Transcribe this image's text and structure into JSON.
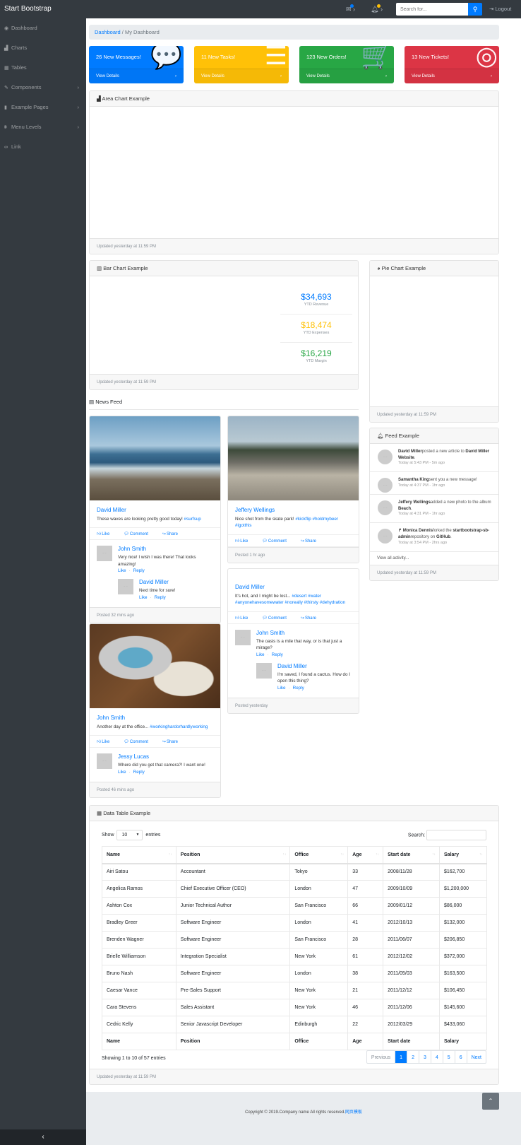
{
  "navbar": {
    "brand": "Start Bootstrap",
    "search_placeholder": "Search for...",
    "logout": "Logout",
    "icons": [
      "envelope-icon",
      "bell-icon",
      "search-icon",
      "sign-out-icon"
    ]
  },
  "sidebar": {
    "items": [
      {
        "label": "Dashboard",
        "icon": "tachometer-icon",
        "glyph": "◉",
        "chevron": ""
      },
      {
        "label": "Charts",
        "icon": "area-chart-icon",
        "glyph": "▟",
        "chevron": ""
      },
      {
        "label": "Tables",
        "icon": "table-icon",
        "glyph": "▦",
        "chevron": ""
      },
      {
        "label": "Components",
        "icon": "wrench-icon",
        "glyph": "✎",
        "chevron": "›"
      },
      {
        "label": "Example Pages",
        "icon": "file-icon",
        "glyph": "▮",
        "chevron": "›"
      },
      {
        "label": "Menu Levels",
        "icon": "sitemap-icon",
        "glyph": "⩩",
        "chevron": "›"
      },
      {
        "label": "Link",
        "icon": "link-icon",
        "glyph": "∞",
        "chevron": ""
      }
    ],
    "toggle": "‹"
  },
  "breadcrumb": {
    "home": "Dashboard",
    "current": "My Dashboard"
  },
  "stats": [
    {
      "title": "26 New Messages!",
      "link": "View Details",
      "color": "#007bff",
      "icon": "comments-icon",
      "glyph": "💬"
    },
    {
      "title": "11 New Tasks!",
      "link": "View Details",
      "color": "#ffc107",
      "icon": "list-icon",
      "glyph": "☰"
    },
    {
      "title": "123 New Orders!",
      "link": "View Details",
      "color": "#28a745",
      "icon": "shopping-cart-icon",
      "glyph": "🛒"
    },
    {
      "title": "13 New Tickets!",
      "link": "View Details",
      "color": "#dc3545",
      "icon": "support-icon",
      "glyph": "◎"
    }
  ],
  "area_chart": {
    "title": "Area Chart Example",
    "footer": "Updated yesterday at 11:59 PM"
  },
  "bar_chart": {
    "title": "Bar Chart Example",
    "footer": "Updated yesterday at 11:59 PM",
    "ytd": [
      {
        "value": "$34,693",
        "label": "YTD Revenue",
        "color": "#007bff"
      },
      {
        "value": "$18,474",
        "label": "YTD Expenses",
        "color": "#ffc107"
      },
      {
        "value": "$16,219",
        "label": "YTD Margin",
        "color": "#28a745"
      }
    ]
  },
  "pie_chart": {
    "title": "Pie Chart Example",
    "footer": "Updated yesterday at 11:59 PM"
  },
  "feed": {
    "title": "Feed Example",
    "view_all": "View all activity...",
    "footer": "Updated yesterday at 11:59 PM",
    "items": [
      {
        "name": "David Miller",
        "action": "posted a new article to ",
        "target": "David Miller Website",
        "end": ".",
        "time": "Today at 5:43 PM - 5m ago"
      },
      {
        "name": "Samantha King",
        "action": "sent you a new message!",
        "target": "",
        "end": "",
        "time": "Today at 4:37 PM - 1hr ago"
      },
      {
        "name": "Jeffery Wellings",
        "action": "added a new photo to the album ",
        "target": "Beach",
        "end": ".",
        "time": "Today at 4:31 PM - 1hr ago"
      },
      {
        "name": "Monica Dennis",
        "prefix": "↱ ",
        "action": "forked the ",
        "target": "startbootstrap-sb-admin",
        "action2": "repository on ",
        "target2": "GitHub",
        "end": ".",
        "time": "Today at 3:54 PM - 2hrs ago"
      }
    ]
  },
  "news_feed": {
    "title": "News Feed",
    "actions": [
      "Like",
      "Comment",
      "Share"
    ],
    "comment_actions": [
      "Like",
      "Reply"
    ],
    "posts": [
      {
        "author": "David Miller",
        "text": "These waves are looking pretty good today! ",
        "tags": "#surfsup",
        "image": "beach",
        "footer": "Posted 32 mins ago",
        "comments": [
          {
            "name": "John Smith",
            "text": "Very nice! I wish I was there! That looks amazing!",
            "replies": [
              {
                "name": "David Miller",
                "text": "Next time for sure!"
              }
            ]
          }
        ]
      },
      {
        "author": "Jeffery Wellings",
        "text": "Nice shot from the skate park! ",
        "tags": "#kickflip #holdmybeer #igotthis",
        "image": "skatepark",
        "footer": "Posted 1 hr ago",
        "comments": []
      },
      {
        "author": "David Miller",
        "text": "It's hot, and I might be lost... ",
        "tags": "#desert #water #anyonehavesomewater #noreally #thirsty #dehydration",
        "image": "",
        "footer": "Posted yesterday",
        "comments": [
          {
            "name": "John Smith",
            "text": "The oasis is a mile that way, or is that just a mirage?",
            "replies": [
              {
                "name": "David Miller",
                "text": "I'm saved, I found a cactus. How do I open this thing?"
              }
            ]
          }
        ]
      },
      {
        "author": "John Smith",
        "text": "Another day at the office... ",
        "tags": "#workinghardorhardlyworking",
        "image": "laptop",
        "footer": "Posted 46 mins ago",
        "comments": [
          {
            "name": "Jessy Lucas",
            "text": "Where did you get that camera?! I want one!",
            "replies": []
          }
        ]
      }
    ]
  },
  "data_table": {
    "title": "Data Table Example",
    "show": "Show",
    "entries": "entries",
    "length": "10",
    "search_label": "Search:",
    "columns": [
      "Name",
      "Position",
      "Office",
      "Age",
      "Start date",
      "Salary"
    ],
    "rows": [
      [
        "Airi Satou",
        "Accountant",
        "Tokyo",
        "33",
        "2008/11/28",
        "$162,700"
      ],
      [
        "Angelica Ramos",
        "Chief Executive Officer (CEO)",
        "London",
        "47",
        "2009/10/09",
        "$1,200,000"
      ],
      [
        "Ashton Cox",
        "Junior Technical Author",
        "San Francisco",
        "66",
        "2009/01/12",
        "$86,000"
      ],
      [
        "Bradley Greer",
        "Software Engineer",
        "London",
        "41",
        "2012/10/13",
        "$132,000"
      ],
      [
        "Brenden Wagner",
        "Software Engineer",
        "San Francisco",
        "28",
        "2011/06/07",
        "$206,850"
      ],
      [
        "Brielle Williamson",
        "Integration Specialist",
        "New York",
        "61",
        "2012/12/02",
        "$372,000"
      ],
      [
        "Bruno Nash",
        "Software Engineer",
        "London",
        "38",
        "2011/05/03",
        "$163,500"
      ],
      [
        "Caesar Vance",
        "Pre-Sales Support",
        "New York",
        "21",
        "2011/12/12",
        "$106,450"
      ],
      [
        "Cara Stevens",
        "Sales Assistant",
        "New York",
        "46",
        "2011/12/06",
        "$145,600"
      ],
      [
        "Cedric Kelly",
        "Senior Javascript Developer",
        "Edinburgh",
        "22",
        "2012/03/29",
        "$433,060"
      ]
    ],
    "info": "Showing 1 to 10 of 57 entries",
    "pagination": [
      "Previous",
      "1",
      "2",
      "3",
      "4",
      "5",
      "6",
      "Next"
    ],
    "active_page": "1",
    "footer": "Updated yesterday at 11:59 PM"
  },
  "footer": {
    "copyright": "Copyright © 2019.Company name All rights reserved.",
    "link": "网页模板",
    "totop": "⌃"
  }
}
